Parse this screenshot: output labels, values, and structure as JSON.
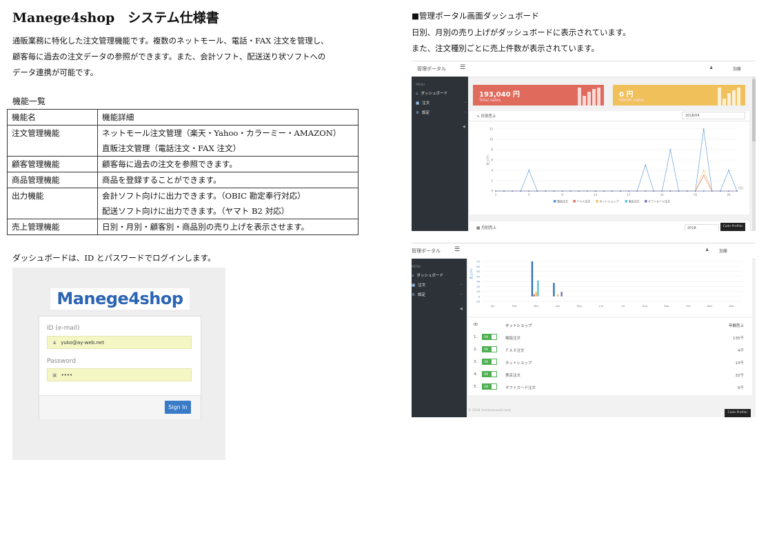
{
  "doc": {
    "title": "Manege4shop　システム仕様書",
    "intro": [
      "通販業務に特化した注文管理機能です。複数のネットモール、電話・FAX 注文を管理し、",
      "顧客毎に過去の注文データの参照ができます。また、会計ソフト、配送送り状ソフトへの",
      "データ連携が可能です。"
    ],
    "features_heading": "機能一覧",
    "features_header": [
      "機能名",
      "機能詳細"
    ],
    "features": [
      {
        "name": "注文管理機能",
        "details": [
          "ネットモール注文管理（楽天・Yahoo・カラーミー・AMAZON）",
          "直販注文管理（電話注文・FAX 注文）"
        ]
      },
      {
        "name": "顧客管理機能",
        "details": [
          "顧客毎に過去の注文を参照できます。"
        ]
      },
      {
        "name": "商品管理機能",
        "details": [
          "商品を登録することができます。"
        ]
      },
      {
        "name": "出力機能",
        "details": [
          "会計ソフト向けに出力できます。（OBIC 勘定奉行対応）",
          "配送ソフト向けに出力できます。（ヤマト B2 対応）"
        ]
      },
      {
        "name": "売上管理機能",
        "details": [
          "日別・月別・顧客別・商品別の売り上げを表示させます。"
        ]
      }
    ],
    "login_caption": "ダッシュボードは、ID とパスワードでログインします。"
  },
  "login": {
    "logo": "Manege4shop",
    "id_label": "ID (e-mail)",
    "id_value": "yuko@ay-web.net",
    "password_label": "Password",
    "password_value": "••••",
    "signin": "Sign In"
  },
  "right": {
    "heading": "■管理ポータル画面ダッシュボード",
    "desc": [
      "日別、月別の売り上げがダッシュボードに表示されています。",
      "また、注文種別ごとに売上件数が表示されています。"
    ]
  },
  "dashboard": {
    "brand": "管理ポータル",
    "user": "加藤",
    "menu_label": "MENU",
    "menu": [
      "ダッシュボード",
      "注文",
      "設定"
    ],
    "kpi_total_value": "193,040 円",
    "kpi_total_label": "Total sales",
    "kpi_month_value": "0 円",
    "kpi_month_label": "Month sales",
    "daily_title": "日別売上",
    "daily_period": "2018/04",
    "monthly_title": "月別売上",
    "monthly_period": "2018",
    "code_profiler": "Code Profiler",
    "footer": "© 2018 manayasuzuki-web",
    "ranking_header": {
      "id": "ID",
      "shop": "ネットショップ",
      "sales": "年間売上"
    },
    "ranking": [
      {
        "n": "1.",
        "name": "電話注文",
        "sales": "135千"
      },
      {
        "n": "2.",
        "name": "ＦＡＸ注文",
        "sales": "4千"
      },
      {
        "n": "3.",
        "name": "ネットショップ",
        "sales": "13千"
      },
      {
        "n": "4.",
        "name": "実店注文",
        "sales": "32千"
      },
      {
        "n": "5.",
        "name": "ギフトカード注文",
        "sales": "9千"
      }
    ],
    "toggle_label": "ON",
    "colors": {
      "red": "#e06a5b",
      "orange": "#f0c15b",
      "sidebar": "#2d3238",
      "toggle": "#4caf50"
    }
  },
  "chart_data": [
    {
      "type": "line",
      "title": "日別売上",
      "x": [
        1,
        2,
        3,
        4,
        5,
        6,
        7,
        8,
        9,
        10,
        11,
        12,
        13,
        14,
        15,
        16,
        17,
        18,
        19,
        20,
        21,
        22,
        23,
        24,
        25,
        26,
        27,
        28,
        29,
        30
      ],
      "x_tick_labels": [
        "1",
        "5",
        "9",
        "13",
        "17",
        "21",
        "25",
        "29"
      ],
      "ylabel": "売上(千)",
      "ylim": [
        0,
        12
      ],
      "xlim": [
        1,
        30
      ],
      "x_axis_end_label": "(日)",
      "y_ticks": [
        0,
        2,
        4,
        6,
        8,
        10,
        12
      ],
      "series": [
        {
          "name": "電話注文",
          "color": "#4a90d9",
          "values": [
            0,
            0,
            0,
            0,
            4,
            0,
            0,
            0,
            0,
            0,
            0,
            0,
            0,
            0,
            0,
            0,
            0,
            0,
            5,
            0,
            0,
            8,
            0,
            0,
            0,
            12,
            0,
            0,
            4,
            0
          ]
        },
        {
          "name": "ＦＡＸ注文",
          "color": "#e06a5b",
          "values": [
            0,
            0,
            0,
            0,
            0,
            0,
            0,
            0,
            0,
            0,
            0,
            0,
            0,
            0,
            0,
            0,
            0,
            0,
            0,
            0,
            0,
            0,
            0,
            0,
            0,
            3,
            0,
            0,
            0,
            0
          ]
        },
        {
          "name": "ネットショップ",
          "color": "#f0c15b",
          "values": [
            0,
            0,
            0,
            0,
            0,
            0,
            0,
            0,
            0,
            0,
            0,
            0,
            0,
            0,
            0,
            0,
            0,
            0,
            0,
            0,
            0,
            0,
            0,
            0,
            0,
            4,
            0,
            0,
            0,
            0
          ]
        },
        {
          "name": "実店注文",
          "color": "#5bc0de",
          "values": [
            0,
            0,
            0,
            0,
            0,
            0,
            0,
            0,
            0,
            0,
            0,
            0,
            0,
            0,
            0,
            0,
            0,
            0,
            0,
            0,
            0,
            0,
            0,
            0,
            0,
            0,
            0,
            0,
            0,
            0
          ]
        },
        {
          "name": "ギフトカード注文",
          "color": "#7d6fb7",
          "values": [
            0,
            0,
            0,
            0,
            0,
            0,
            0,
            0,
            0,
            0,
            0,
            0,
            0,
            0,
            0,
            0,
            0,
            0,
            0,
            0,
            0,
            0,
            0,
            0,
            0,
            0,
            0,
            0,
            0,
            0
          ]
        }
      ],
      "legend": "bottom"
    },
    {
      "type": "bar",
      "title": "月別売上",
      "ylabel": "売上(千)",
      "categories": [
        "Jan",
        "Feb",
        "Mar",
        "Apr",
        "May",
        "Jun",
        "Jul",
        "Aug",
        "Sep",
        "Oct",
        "Nov",
        "Dec"
      ],
      "ylim": [
        -10,
        70
      ],
      "y_ticks": [
        -10,
        0,
        10,
        20,
        30,
        40,
        50,
        60,
        70
      ],
      "series": [
        {
          "color": "#2f6fb7",
          "values": [
            0,
            0,
            135,
            27,
            0,
            0,
            0,
            0,
            0,
            0,
            0,
            0
          ]
        },
        {
          "color": "#e06a5b",
          "values": [
            0,
            0,
            4,
            0,
            0,
            0,
            0,
            0,
            0,
            0,
            0,
            0
          ]
        },
        {
          "color": "#f0c15b",
          "values": [
            0,
            0,
            9,
            4,
            0,
            0,
            0,
            0,
            0,
            0,
            0,
            0
          ]
        },
        {
          "color": "#5bc0de",
          "values": [
            0,
            0,
            32,
            0,
            0,
            0,
            0,
            0,
            0,
            0,
            0,
            0
          ]
        },
        {
          "color": "#7d6fb7",
          "values": [
            0,
            0,
            0,
            9,
            0,
            0,
            0,
            0,
            0,
            0,
            0,
            0
          ]
        }
      ]
    }
  ]
}
